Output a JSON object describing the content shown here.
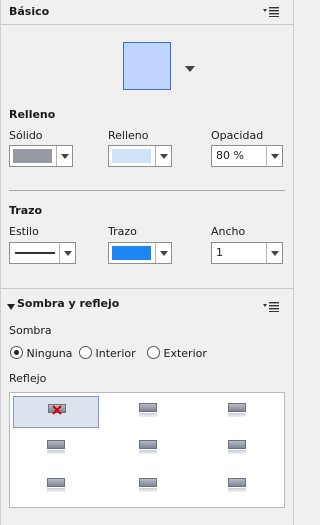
{
  "basic": {
    "title": "Básico",
    "preview_color": "#bfd5ff"
  },
  "fill": {
    "title": "Relleno",
    "solid_label": "Sólido",
    "fill_label": "Relleno",
    "opacity_label": "Opacidad",
    "solid_color": "#9699a1",
    "fill_color": "#cfe3f8",
    "opacity_value": "80 %"
  },
  "stroke": {
    "title": "Trazo",
    "style_label": "Estilo",
    "stroke_label": "Trazo",
    "width_label": "Ancho",
    "stroke_color": "#1e86f0",
    "width_value": "1"
  },
  "shadow": {
    "title": "Sombra y reflejo",
    "shadow_label": "Sombra",
    "options": [
      "Ninguna",
      "Interior",
      "Exterior"
    ],
    "selected": "Ninguna",
    "reflection_label": "Reflejo"
  },
  "colors": {
    "accent": "#1e86f0",
    "none_x": "#d20000"
  }
}
